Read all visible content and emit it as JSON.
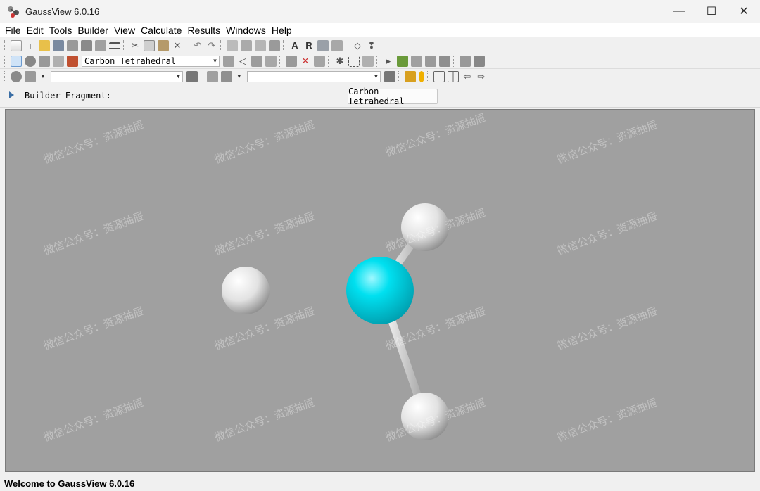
{
  "window": {
    "title": "GaussView 6.0.16",
    "minimize": "—",
    "maximize": "☐",
    "close": "✕"
  },
  "menu": [
    "File",
    "Edit",
    "Tools",
    "Builder",
    "View",
    "Calculate",
    "Results",
    "Windows",
    "Help"
  ],
  "toolbar2": {
    "fragment_combo": "Carbon Tetrahedral"
  },
  "toolbar3": {
    "combo_a": "",
    "combo_b": "",
    "combo_c": ""
  },
  "builder": {
    "label": "Builder Fragment:",
    "fragment": "Carbon Tetrahedral"
  },
  "molecule": {
    "central_atom_color": "#00d8e8",
    "h_atom_color": "#ececec",
    "background": "#a0a0a0"
  },
  "watermark": "微信公众号：资源抽屉",
  "status": {
    "text": "Welcome to GaussView 6.0.16"
  },
  "colors": {
    "titlebar": "#f3f3f3",
    "viewport": "#a0a0a0"
  }
}
